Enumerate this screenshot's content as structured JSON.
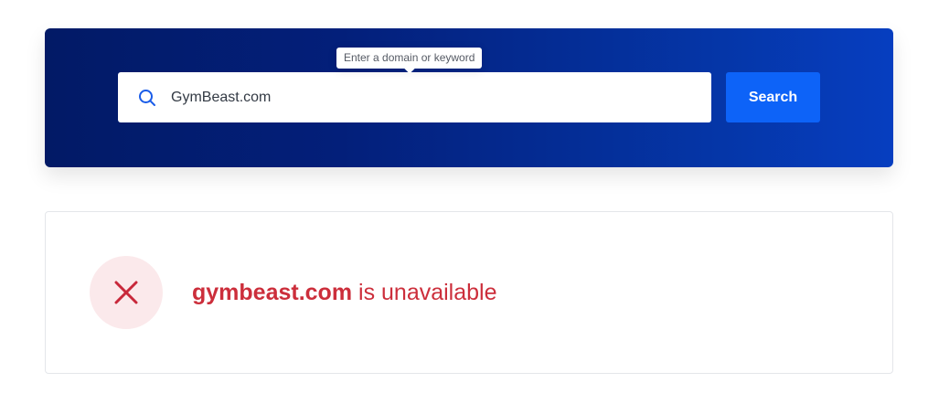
{
  "search": {
    "tooltip": "Enter a domain or keyword",
    "value": "GymBeast.com",
    "button_label": "Search",
    "icon": "search-icon"
  },
  "result": {
    "domain": "gymbeast.com",
    "status_text": " is unavailable",
    "icon": "close-icon"
  },
  "colors": {
    "brand_dark": "#021a66",
    "brand_light": "#063ec0",
    "button": "#0d63f8",
    "error": "#cc2e3b",
    "error_bg": "#fbe9eb"
  }
}
